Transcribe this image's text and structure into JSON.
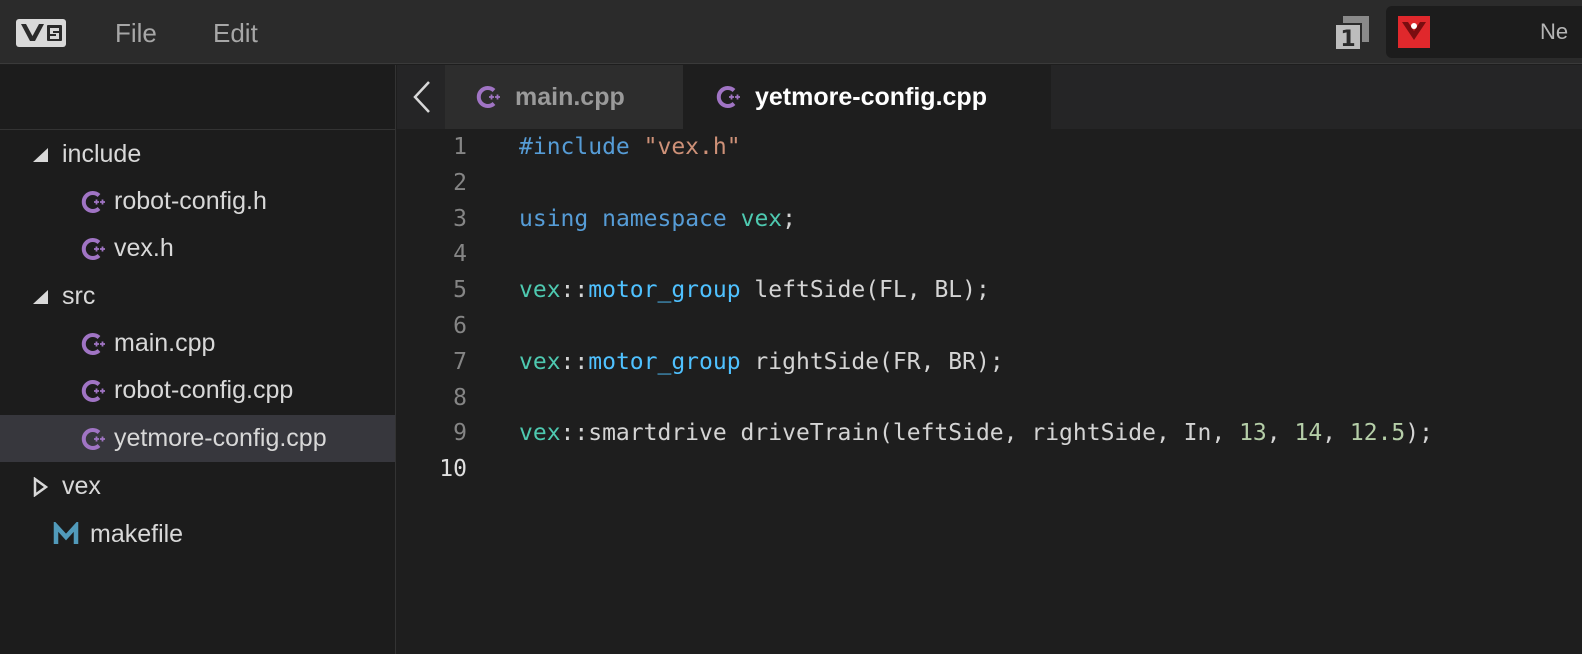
{
  "menubar": {
    "menus": [
      "File",
      "Edit"
    ],
    "window_badge": "1",
    "brand_text": "Ne"
  },
  "sidebar": {
    "tree": [
      {
        "label": "include",
        "kind": "folder",
        "expanded": true,
        "icon": "triangle-down-icon"
      },
      {
        "label": "robot-config.h",
        "kind": "file",
        "icon": "cpp-file-icon"
      },
      {
        "label": "vex.h",
        "kind": "file",
        "icon": "cpp-file-icon"
      },
      {
        "label": "src",
        "kind": "folder",
        "expanded": true,
        "icon": "triangle-down-icon"
      },
      {
        "label": "main.cpp",
        "kind": "file",
        "icon": "cpp-file-icon"
      },
      {
        "label": "robot-config.cpp",
        "kind": "file",
        "icon": "cpp-file-icon"
      },
      {
        "label": "yetmore-config.cpp",
        "kind": "file",
        "icon": "cpp-file-icon",
        "selected": true
      },
      {
        "label": "vex",
        "kind": "folder",
        "expanded": false,
        "icon": "triangle-right-icon"
      },
      {
        "label": "makefile",
        "kind": "file",
        "icon": "makefile-m-icon"
      }
    ]
  },
  "tabs": [
    {
      "label": "main.cpp",
      "active": false
    },
    {
      "label": "yetmore-config.cpp",
      "active": true
    }
  ],
  "editor": {
    "current_line": 10,
    "lines": [
      {
        "n": "1",
        "tokens": [
          {
            "t": "#include ",
            "c": "kw"
          },
          {
            "t": "\"vex.h\"",
            "c": "str"
          }
        ]
      },
      {
        "n": "2",
        "tokens": []
      },
      {
        "n": "3",
        "tokens": [
          {
            "t": "using",
            "c": "kw"
          },
          {
            "t": " ",
            "c": ""
          },
          {
            "t": "namespace",
            "c": "kw"
          },
          {
            "t": " ",
            "c": ""
          },
          {
            "t": "vex",
            "c": "ns"
          },
          {
            "t": ";",
            "c": ""
          }
        ]
      },
      {
        "n": "4",
        "tokens": []
      },
      {
        "n": "5",
        "tokens": [
          {
            "t": "vex",
            "c": "ns"
          },
          {
            "t": "::",
            "c": ""
          },
          {
            "t": "motor_group",
            "c": "type"
          },
          {
            "t": " leftSide(FL, BL);",
            "c": ""
          }
        ]
      },
      {
        "n": "6",
        "tokens": []
      },
      {
        "n": "7",
        "tokens": [
          {
            "t": "vex",
            "c": "ns"
          },
          {
            "t": "::",
            "c": ""
          },
          {
            "t": "motor_group",
            "c": "type"
          },
          {
            "t": " rightSide(FR, BR);",
            "c": ""
          }
        ]
      },
      {
        "n": "8",
        "tokens": []
      },
      {
        "n": "9",
        "tokens": [
          {
            "t": "vex",
            "c": "ns"
          },
          {
            "t": "::smartdrive driveTrain(leftSide, rightSide, In, ",
            "c": ""
          },
          {
            "t": "13",
            "c": "num"
          },
          {
            "t": ", ",
            "c": ""
          },
          {
            "t": "14",
            "c": "num"
          },
          {
            "t": ", ",
            "c": ""
          },
          {
            "t": "12.5",
            "c": "num"
          },
          {
            "t": ");",
            "c": ""
          }
        ]
      },
      {
        "n": "10",
        "tokens": []
      }
    ]
  },
  "colors": {
    "keyword": "#569cd6",
    "string": "#ce9178",
    "namespace": "#4ec9b0",
    "type": "#4fc1ff",
    "number": "#b5cea8",
    "cpp_icon": "#a074c4",
    "makefile_icon": "#519aba",
    "brand_red": "#e0282c"
  }
}
